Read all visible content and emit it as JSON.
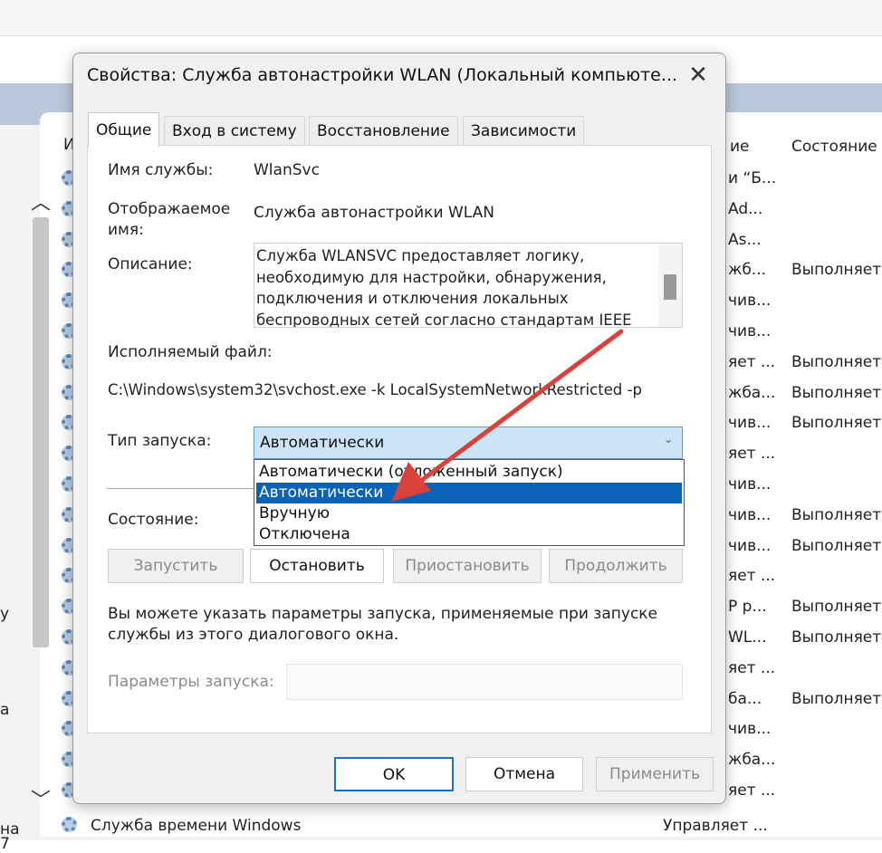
{
  "background": {
    "edge_left": [
      "у",
      "а",
      "на",
      "7"
    ],
    "rows": [
      {
        "col_a": "и “Б...",
        "col_b": ""
      },
      {
        "col_a": "Ad...",
        "col_b": ""
      },
      {
        "col_a": "As...",
        "col_b": ""
      },
      {
        "col_a": "жб...",
        "col_b": "Выполняет"
      },
      {
        "col_a": "чив...",
        "col_b": ""
      },
      {
        "col_a": "чив...",
        "col_b": ""
      },
      {
        "col_a": "яет ...",
        "col_b": "Выполняет"
      },
      {
        "col_a": "жба...",
        "col_b": "Выполняет"
      },
      {
        "col_a": "чив...",
        "col_b": "Выполняет"
      },
      {
        "col_a": "яет ...",
        "col_b": ""
      },
      {
        "col_a": "чив...",
        "col_b": ""
      },
      {
        "col_a": "чив...",
        "col_b": "Выполняет"
      },
      {
        "col_a": "чив...",
        "col_b": "Выполняет"
      },
      {
        "col_a": "яет ...",
        "col_b": ""
      },
      {
        "col_a": "P р...",
        "col_b": "Выполняет"
      },
      {
        "col_a": "WL...",
        "col_b": "Выполняет"
      },
      {
        "col_a": "яет ...",
        "col_b": ""
      },
      {
        "col_a": "ба...",
        "col_b": "Выполняет"
      },
      {
        "col_a": "чив...",
        "col_b": ""
      },
      {
        "col_a": "жба...",
        "col_b": ""
      },
      {
        "col_a": "яет ...",
        "col_b": ""
      }
    ],
    "header_partial": "ие",
    "header_state": "Состояние",
    "header_left": "И",
    "last_row_name": "Служба времени Windows",
    "last_row_start": "Управляет ...",
    "scroll_up_icon": "chevron-up-icon",
    "scroll_down_icon": "chevron-down-icon"
  },
  "dialog": {
    "title": "Свойства: Служба автонастройки WLAN (Локальный компьюте...",
    "close_glyph": "✕",
    "tabs": [
      "Общие",
      "Вход в систему",
      "Восстановление",
      "Зависимости"
    ],
    "service_name_label": "Имя службы:",
    "service_name": "WlanSvc",
    "display_name_label_1": "Отображаемое",
    "display_name_label_2": "имя:",
    "display_name": "Служба автонастройки WLAN",
    "description_label": "Описание:",
    "description": "Служба WLANSVC предоставляет логику, необходимую для настройки, обнаружения, подключения и отключения локальных беспроводных сетей согласно стандартам IEEE",
    "exe_label": "Исполняемый файл:",
    "exe_path": "C:\\Windows\\system32\\svchost.exe -k LocalSystemNetworkRestricted -p",
    "startup_label": "Тип запуска:",
    "startup_value": "Автоматически",
    "startup_options": [
      "Автоматически (отложенный запуск)",
      "Автоматически",
      "Вручную",
      "Отключена"
    ],
    "startup_selected_index": 1,
    "status_label": "Состояние:",
    "buttons": {
      "start": "Запустить",
      "stop": "Остановить",
      "pause": "Приостановить",
      "resume": "Продолжить"
    },
    "hint": "Вы можете указать параметры запуска, применяемые при запуске службы из этого диалогового окна.",
    "params_label": "Параметры запуска:",
    "params_value": "",
    "ok": "OK",
    "cancel": "Отмена",
    "apply": "Применить"
  },
  "colors": {
    "accent": "#0a63b8",
    "annotation_arrow": "#d9413a"
  }
}
